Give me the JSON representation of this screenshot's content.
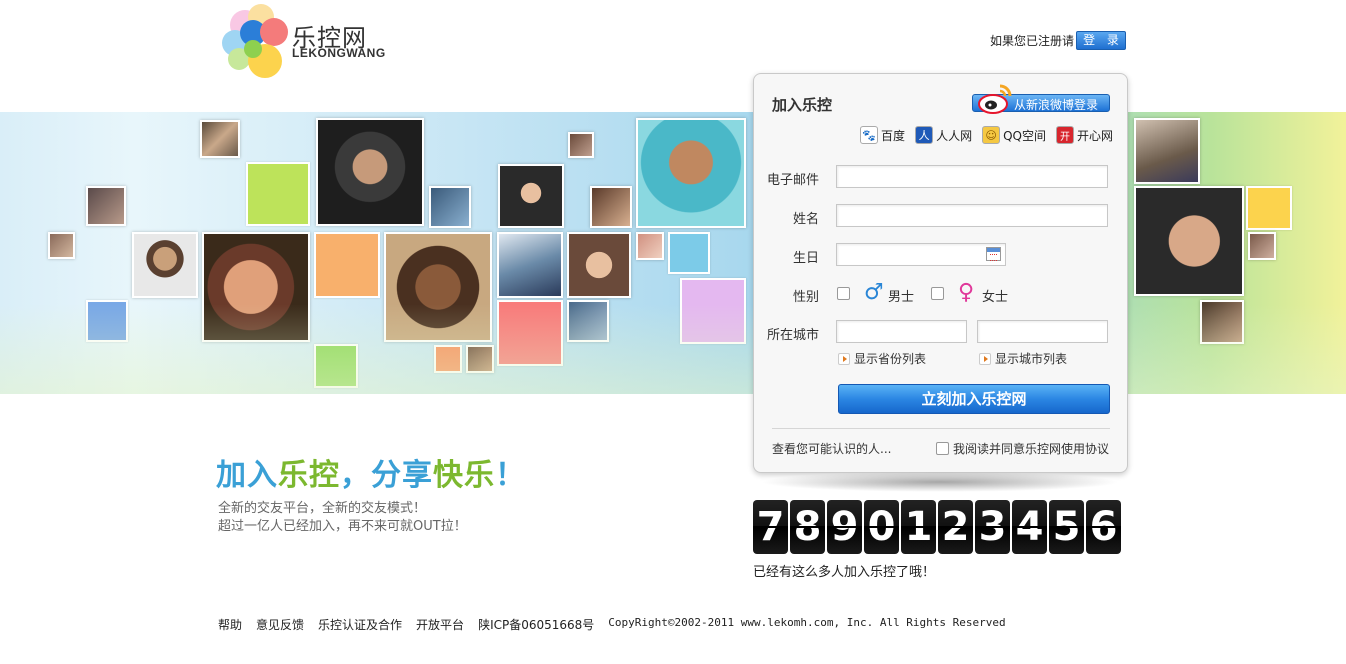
{
  "logo": {
    "name_cn": "乐控网",
    "name_en": "LEKONGWANG"
  },
  "top_login": {
    "prompt": "如果您已注册请",
    "button": "登 录"
  },
  "panel": {
    "title": "加入乐控",
    "weibo_button": "从新浪微博登录",
    "partners": [
      {
        "icon": "baidu-paw-icon",
        "glyph": "🐾",
        "label": "百度"
      },
      {
        "icon": "renren-icon",
        "glyph": "人",
        "label": "人人网"
      },
      {
        "icon": "qq-zone-icon",
        "glyph": "☺",
        "label": "QQ空间"
      },
      {
        "icon": "kaixin-icon",
        "glyph": "开",
        "label": "开心网"
      }
    ],
    "email_label": "电子邮件",
    "name_label": "姓名",
    "birthday_label": "生日",
    "gender_label": "性别",
    "male_label": "男士",
    "female_label": "女士",
    "city_label": "所在城市",
    "province_list_link": "显示省份列表",
    "city_list_link": "显示城市列表",
    "submit": "立刻加入乐控网",
    "people_link": "查看您可能认识的人...",
    "agreement": "我阅读并同意乐控网使用协议"
  },
  "counter": {
    "digits": [
      "7",
      "8",
      "9",
      "0",
      "1",
      "2",
      "3",
      "4",
      "5",
      "6"
    ],
    "caption": "已经有这么多人加入乐控了哦！"
  },
  "slogan": {
    "part1": "加入",
    "part2": "乐控",
    "part3": "，分享",
    "part4": "快乐",
    "part5": "！"
  },
  "subtitle": {
    "line1": "全新的交友平台，全新的交友模式！",
    "line2": "超过一亿人已经加入，再不来可就OUT拉！"
  },
  "footer": {
    "links": [
      "帮助",
      "意见反馈",
      "乐控认证及合作",
      "开放平台",
      "陕ICP备06051668号"
    ],
    "copyright": "CopyRight©2002-2011 www.lekomh.com, Inc. All Rights Reserved"
  },
  "colors": {
    "brand_blue": "#3aa0d6",
    "brand_green": "#7cb82f",
    "button_blue": "#2b86e3"
  }
}
